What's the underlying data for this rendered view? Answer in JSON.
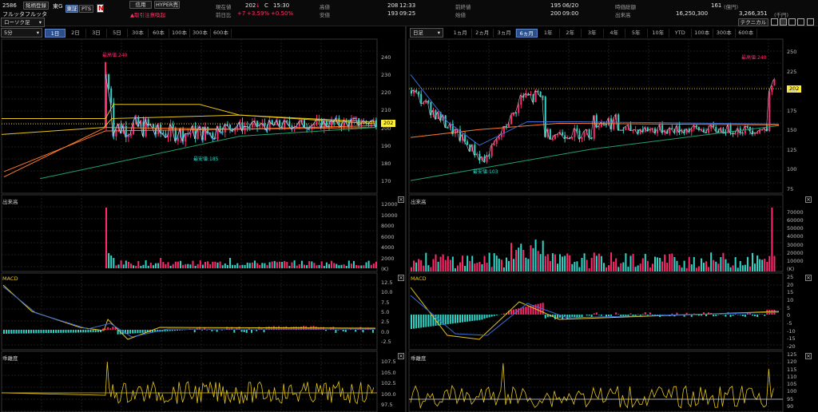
{
  "header": {
    "code": "2586",
    "name_button": "銘柄登録",
    "market": "東G",
    "btn_tosho": "東証",
    "btn_pts": "PTS",
    "company": "フルッタフルッタ",
    "btn_shinyo": "信用",
    "btn_hyper": "HYPER売",
    "warning": "▲取引注意喚起",
    "current_label": "現在値",
    "current_value": "202",
    "current_arrow": "↓",
    "current_c": "C",
    "current_time": "15:30",
    "change_label": "前日比",
    "change_value": "+7",
    "change_pct1": "+3.59%",
    "change_pct2": "+0.50%",
    "high_label": "高値",
    "high_value": "208",
    "high_time": "12:33",
    "low_label": "安値",
    "low_value": "193",
    "low_time": "09:25",
    "prev_label": "前終値",
    "prev_value": "195",
    "prev_date": "06/20",
    "open_label": "始値",
    "open_value": "200",
    "open_time": "09:00",
    "mcap_label": "時価総額",
    "mcap_value": "161",
    "mcap_unit": "(億円)",
    "vol_label": "出来高",
    "vol_value": "16,250,300",
    "turnover_value": "3,266,351",
    "turnover_unit": "(千円)",
    "technical_btn": "テクニカル"
  },
  "left": {
    "candle_select": "ローソク足",
    "interval_select": "5分",
    "tabs": [
      "1日",
      "2日",
      "3日",
      "5日",
      "30本",
      "60本",
      "100本",
      "300本",
      "600本"
    ],
    "selected_tab": 0,
    "high_annot": "最高値:240",
    "low_annot": "最安値:185",
    "price_tag": "202",
    "price_axis": [
      "240",
      "230",
      "220",
      "210",
      "200",
      "190",
      "180",
      "170"
    ],
    "volume_title": "出来高",
    "volume_axis": [
      "12000",
      "10000",
      "8000",
      "6000",
      "4000",
      "2000",
      "(K)"
    ],
    "macd_title": "MACD",
    "macd_axis": [
      "12.5",
      "10.0",
      "7.5",
      "5.0",
      "2.5",
      "0.0",
      "-2.5"
    ],
    "osc_title": "乖離度",
    "osc_axis": [
      "107.5",
      "105.0",
      "102.5",
      "100.0",
      "97.5"
    ]
  },
  "right": {
    "interval_select": "日足",
    "tabs": [
      "1ヵ月",
      "2ヵ月",
      "3ヵ月",
      "6ヵ月",
      "1年",
      "2年",
      "3年",
      "4年",
      "5年",
      "10年",
      "YTD",
      "100本",
      "300本",
      "600本"
    ],
    "selected_tab": 3,
    "high_annot": "最高値:240",
    "low_annot": "最安値:103",
    "price_tag": "202",
    "price_axis": [
      "250",
      "225",
      "200",
      "175",
      "150",
      "125",
      "100",
      "75"
    ],
    "volume_title": "出来高",
    "volume_axis": [
      "70000",
      "60000",
      "50000",
      "40000",
      "30000",
      "20000",
      "10000",
      "(K)"
    ],
    "macd_title": "MACD",
    "macd_axis": [
      "25",
      "20",
      "15",
      "10",
      "5",
      "0",
      "-5",
      "-10",
      "-15",
      "-20"
    ],
    "osc_title": "乖離度",
    "osc_axis": [
      "125",
      "120",
      "115",
      "110",
      "105",
      "100",
      "95",
      "90"
    ]
  },
  "colors": {
    "up": "#ff2a6d",
    "down": "#30d5c8",
    "ma_yellow": "#e6c619",
    "ma_orange": "#ff7a2a",
    "ma_blue": "#3b6dd8",
    "ma_green": "#20a070",
    "price_tag_bg": "#ffee33",
    "selected_tab": "#2a4f8a"
  }
}
